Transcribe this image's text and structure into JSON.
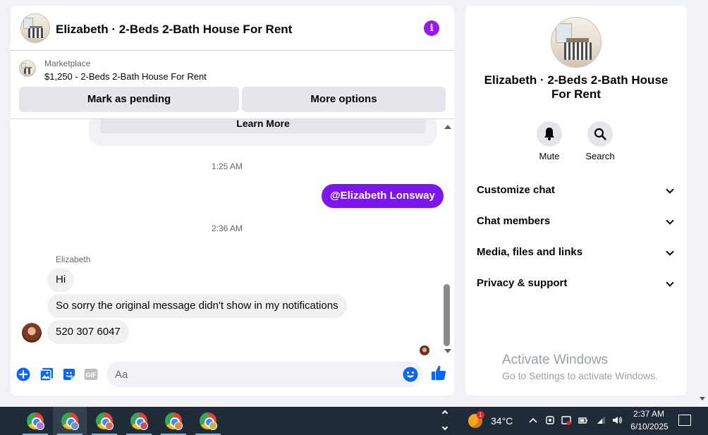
{
  "chat": {
    "title": "Elizabeth · 2-Beds 2-Bath House For Rent",
    "marketplace_label": "Marketplace",
    "listing_text": "$1,250 - 2-Beds 2-Bath House For Rent",
    "mark_pending_label": "Mark as pending",
    "more_options_label": "More options",
    "learn_more_label": "Learn More",
    "time_1": "1:25 AM",
    "outgoing_message": "@Elizabeth Lonsway",
    "time_2": "2:36 AM",
    "sender_name": "Elizabeth",
    "incoming_messages": [
      "Hi",
      "So sorry the original message didn't show in my notifications",
      "520 307 6047"
    ],
    "composer_placeholder": "Aa",
    "composer_icons": [
      "plus-icon",
      "photo-icon",
      "sticker-icon",
      "gif-icon",
      "emoji-icon",
      "thumbs-up-icon"
    ],
    "gif_label": "GIF"
  },
  "info_panel": {
    "name": "Elizabeth · 2-Beds 2-Bath House For Rent",
    "mute_label": "Mute",
    "search_label": "Search",
    "sections": [
      "Customize chat",
      "Chat members",
      "Media, files and links",
      "Privacy & support"
    ]
  },
  "watermark": {
    "title": "Activate Windows",
    "subtitle": "Go to Settings to activate Windows."
  },
  "taskbar": {
    "temperature": "34°C",
    "weather_badge": "1",
    "time": "2:37 AM",
    "date": "6/10/2025"
  },
  "colors": {
    "accent_purple": "#7b16f0",
    "info_icon": "#9b18f2",
    "messenger_blue": "#0866ff",
    "taskbar": "#1f2b36"
  }
}
